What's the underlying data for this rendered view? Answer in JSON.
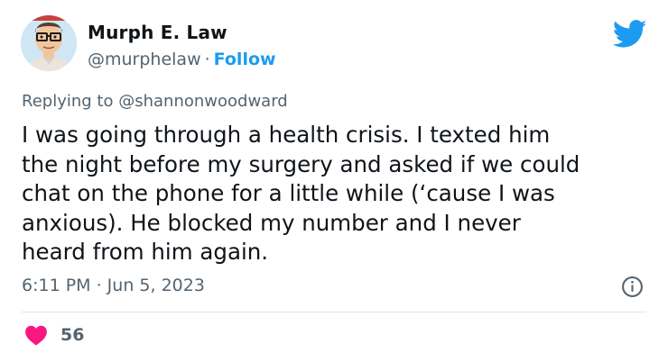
{
  "tweet": {
    "author_name": "Murph E. Law",
    "handle": "@murphelaw",
    "separator": "·",
    "follow_label": "Follow",
    "replying_prefix": "Replying to",
    "replying_to": "@shannonwoodward",
    "text": "I was going through a health crisis. I texted him\nthe night before my surgery and asked if we could\nchat on the phone for a little while (‘cause I was\nanxious). He blocked my number and I never\nheard from him again.",
    "timestamp": "6:11 PM · Jun 5, 2023",
    "like_count": "56"
  },
  "icons": {
    "brand": "twitter-bird-icon",
    "info": "info-icon",
    "like": "heart-icon",
    "avatar": "cartoon-avatar"
  },
  "colors": {
    "accent": "#1d9bf0",
    "text_primary": "#0f1419",
    "text_secondary": "#536471",
    "like": "#f91880",
    "divider": "#dfe3e7"
  }
}
